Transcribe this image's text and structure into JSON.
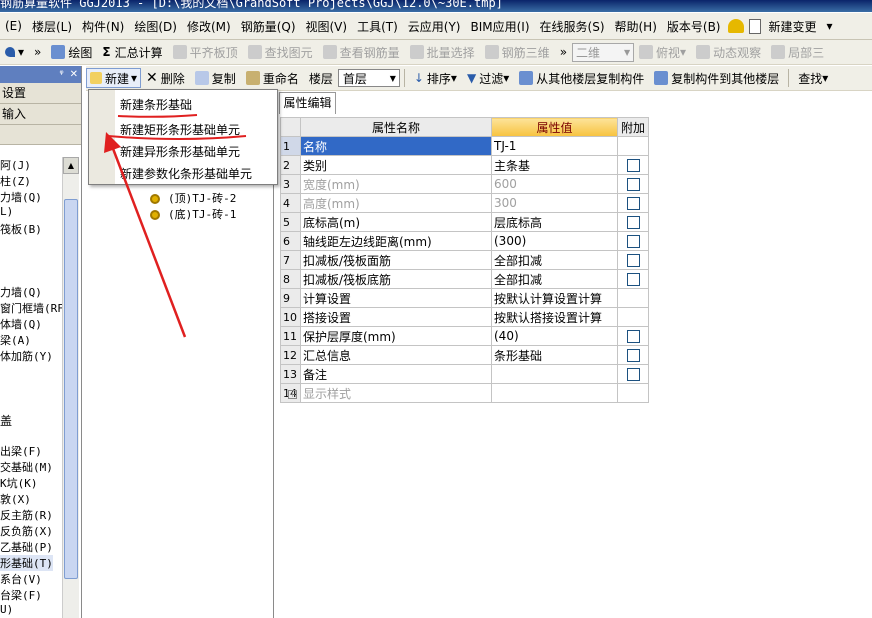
{
  "app": {
    "title": "钢筋算量软件 GGJ2013 - [D:\\我的文档\\GrandSoft Projects\\GGJ\\12.0\\~30E.tmp]"
  },
  "menu": {
    "items": [
      "(E)",
      "楼层(L)",
      "构件(N)",
      "绘图(D)",
      "修改(M)",
      "钢筋量(Q)",
      "视图(V)",
      "工具(T)",
      "云应用(Y)",
      "BIM应用(I)",
      "在线服务(S)",
      "帮助(H)",
      "版本号(B)",
      "新建变更"
    ]
  },
  "toolbar1": {
    "draw": "绘图",
    "sum": "汇总计算",
    "flat": "平齐板顶",
    "find_elem": "查找图元",
    "view_rebar": "查看钢筋量",
    "batch_select": "批量选择",
    "rebar_3d": "钢筋三维",
    "view_mode": "二维",
    "top_view": "俯视",
    "dynamic": "动态观察",
    "local": "局部三"
  },
  "left_panel": {
    "buttons": [
      "设置",
      "输入"
    ],
    "items": [
      "阿(J)",
      "柱(Z)",
      "力墙(Q)",
      "L)",
      "筏板(B)",
      "力墙(Q)",
      "窗门框墙(RF",
      "体墙(Q)",
      "梁(A)",
      "体加筋(Y)",
      "盖",
      "出梁(F)",
      "交基础(M)",
      "K坑(K)",
      "敦(X)",
      "反主筋(R)",
      "反负筋(X)",
      "乙基础(P)",
      "形基础(T)",
      "系台(V)",
      "台梁(F)",
      "U)"
    ]
  },
  "tree_toolbar": {
    "new": "新建",
    "delete": "删除",
    "copy": "复制",
    "rename": "重命名",
    "floor_label": "楼层",
    "floor_value": "首层",
    "sort": "排序",
    "filter": "过滤",
    "copy_from_floor": "从其他楼层复制构件",
    "copy_to_floor": "复制构件到其他楼层",
    "find": "查找"
  },
  "new_menu": {
    "items": [
      "新建条形基础",
      "新建矩形条形基础单元",
      "新建异形条形基础单元",
      "新建参数化条形基础单元"
    ]
  },
  "tree": {
    "nodes": [
      "(顶)TJ-砖-2",
      "(底)TJ-砖-1"
    ]
  },
  "properties": {
    "tab": "属性编辑",
    "headers": {
      "name": "属性名称",
      "value": "属性值",
      "extra": "附加"
    },
    "rows": [
      {
        "no": "1",
        "name": "名称",
        "value": "TJ-1",
        "check": false,
        "gray": false
      },
      {
        "no": "2",
        "name": "类别",
        "value": "主条基",
        "check": true,
        "gray": false
      },
      {
        "no": "3",
        "name": "宽度(mm)",
        "value": "600",
        "check": true,
        "gray": true
      },
      {
        "no": "4",
        "name": "高度(mm)",
        "value": "300",
        "check": true,
        "gray": true
      },
      {
        "no": "5",
        "name": "底标高(m)",
        "value": "层底标高",
        "check": true,
        "gray": false
      },
      {
        "no": "6",
        "name": "轴线距左边线距离(mm)",
        "value": "(300)",
        "check": true,
        "gray": false
      },
      {
        "no": "7",
        "name": "扣减板/筏板面筋",
        "value": "全部扣减",
        "check": true,
        "gray": false
      },
      {
        "no": "8",
        "name": "扣减板/筏板底筋",
        "value": "全部扣减",
        "check": true,
        "gray": false
      },
      {
        "no": "9",
        "name": "计算设置",
        "value": "按默认计算设置计算",
        "check": false,
        "gray": false
      },
      {
        "no": "10",
        "name": "搭接设置",
        "value": "按默认搭接设置计算",
        "check": false,
        "gray": false
      },
      {
        "no": "11",
        "name": "保护层厚度(mm)",
        "value": "(40)",
        "check": true,
        "gray": false
      },
      {
        "no": "12",
        "name": "汇总信息",
        "value": "条形基础",
        "check": true,
        "gray": false
      },
      {
        "no": "13",
        "name": "备注",
        "value": "",
        "check": true,
        "gray": false
      },
      {
        "no": "14",
        "name": "显示样式",
        "value": "",
        "check": false,
        "gray": true
      }
    ]
  },
  "colors": {
    "selection": "#3169c6",
    "annotation": "#e02020",
    "value_header": "#f7c23e"
  }
}
